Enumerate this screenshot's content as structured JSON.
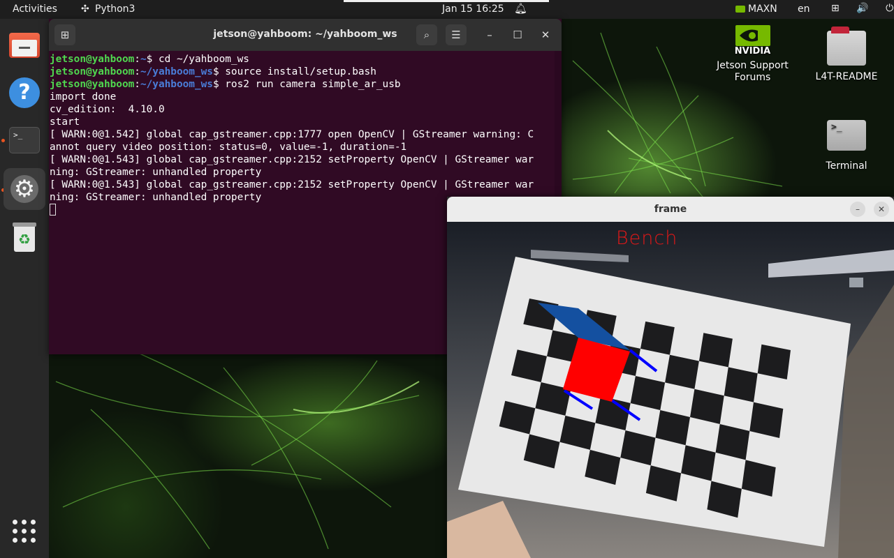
{
  "topbar": {
    "activities": "Activities",
    "app_name": "Python3",
    "clock": "Jan 15  16:25",
    "power_mode": "MAXN",
    "language": "en",
    "tray": "⊞ 🔊 ⏻"
  },
  "dock": {
    "items": [
      "files",
      "help",
      "terminal",
      "settings",
      "trash"
    ]
  },
  "terminal": {
    "title": "jetson@yahboom: ~/yahboom_ws",
    "lines": [
      {
        "user": "jetson@yahboom",
        "path": "~",
        "cmd": "$ cd ~/yahboom_ws"
      },
      {
        "user": "jetson@yahboom",
        "path": "~/yahboom_ws",
        "cmd": "$ source install/setup.bash"
      },
      {
        "user": "jetson@yahboom",
        "path": "~/yahboom_ws",
        "cmd": "$ ros2 run camera simple_ar_usb"
      }
    ],
    "output": [
      "import done",
      "cv_edition:  4.10.0",
      "start",
      "[ WARN:0@1.542] global cap_gstreamer.cpp:1777 open OpenCV | GStreamer warning: C",
      "annot query video position: status=0, value=-1, duration=-1",
      "[ WARN:0@1.543] global cap_gstreamer.cpp:2152 setProperty OpenCV | GStreamer war",
      "ning: GStreamer: unhandled property",
      "[ WARN:0@1.543] global cap_gstreamer.cpp:2152 setProperty OpenCV | GStreamer war",
      "ning: GStreamer: unhandled property"
    ]
  },
  "desktop_icons": {
    "nvidia_brand": "NVIDIA",
    "nvidia_label": "Jetson Support Forums",
    "readme_label": "L4T-README",
    "terminal_label": "Terminal"
  },
  "frame": {
    "title": "frame",
    "overlay_label": "Bench"
  },
  "colors": {
    "terminal_bg": "#300a24",
    "prompt_user": "#4fd74f",
    "prompt_path": "#4a7dd8",
    "accent": "#e95420",
    "ar_cube_face": "#ff0000",
    "ar_cube_top": "#1450a0",
    "ar_cube_edges": "#0000ff"
  }
}
